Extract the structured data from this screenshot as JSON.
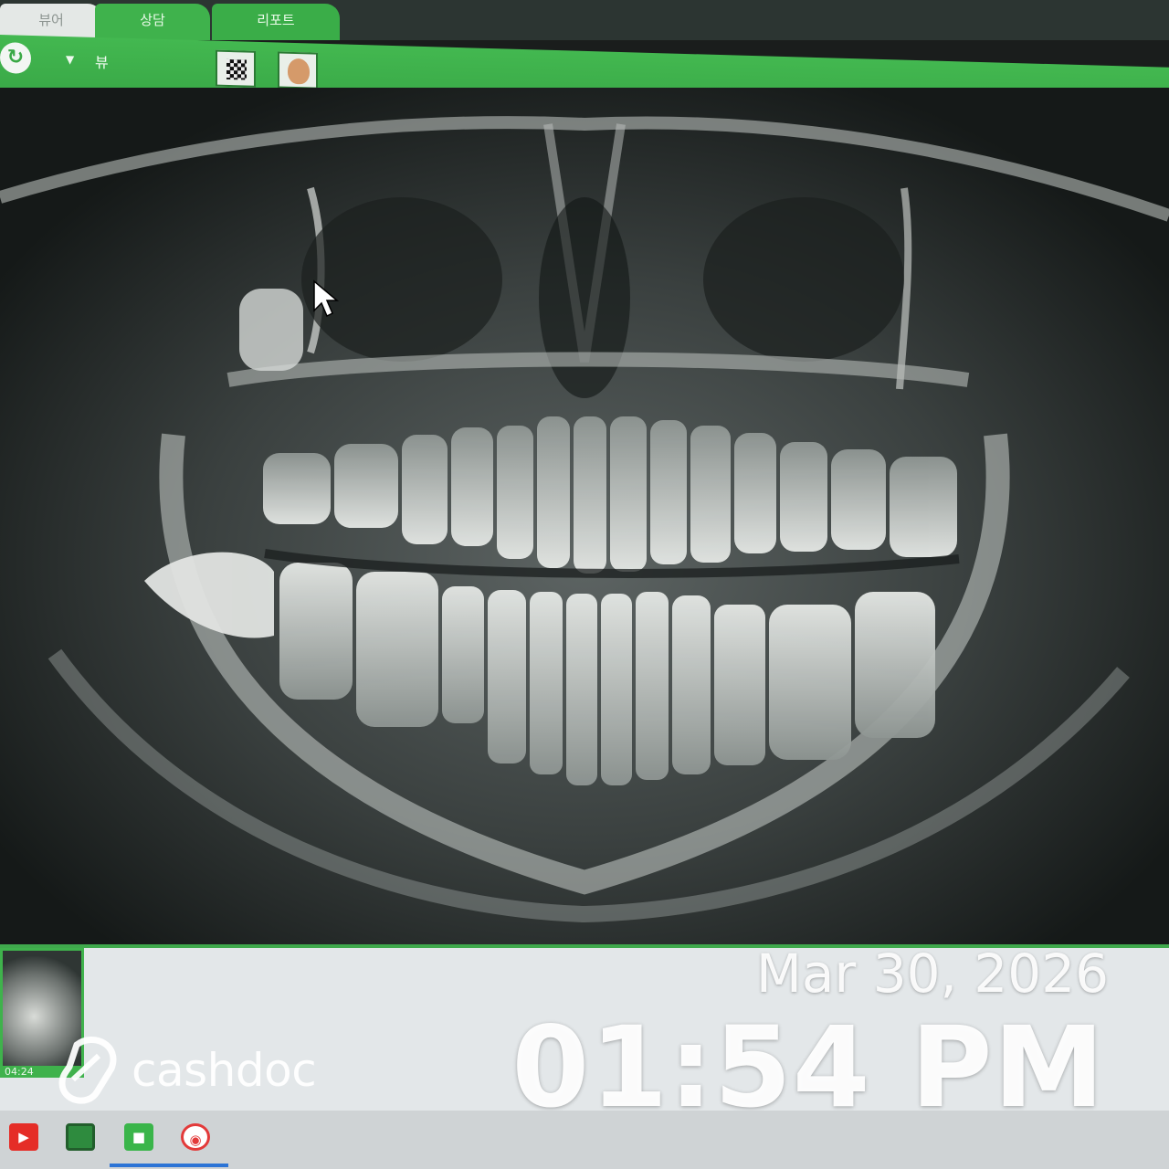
{
  "tabs": [
    {
      "label": "뷰어"
    },
    {
      "label": "상담"
    },
    {
      "label": "리포트"
    }
  ],
  "toolbar": {
    "view_label": "뷰",
    "logo_icon": "refresh-logo-icon",
    "tool_icons": [
      "checker-grid-icon",
      "face-photo-icon"
    ]
  },
  "thumbnail": {
    "time_label": "04:24"
  },
  "overlay": {
    "date": "Mar 30, 2026",
    "time": "01:54 PM",
    "brand": "cashdoc"
  },
  "taskbar": {
    "icons": [
      "youtube-icon",
      "green-app-icon",
      "camera-app-icon",
      "red-app-icon"
    ]
  },
  "colors": {
    "accent_green": "#3fb24c",
    "xray_bg": "#0f1211"
  }
}
